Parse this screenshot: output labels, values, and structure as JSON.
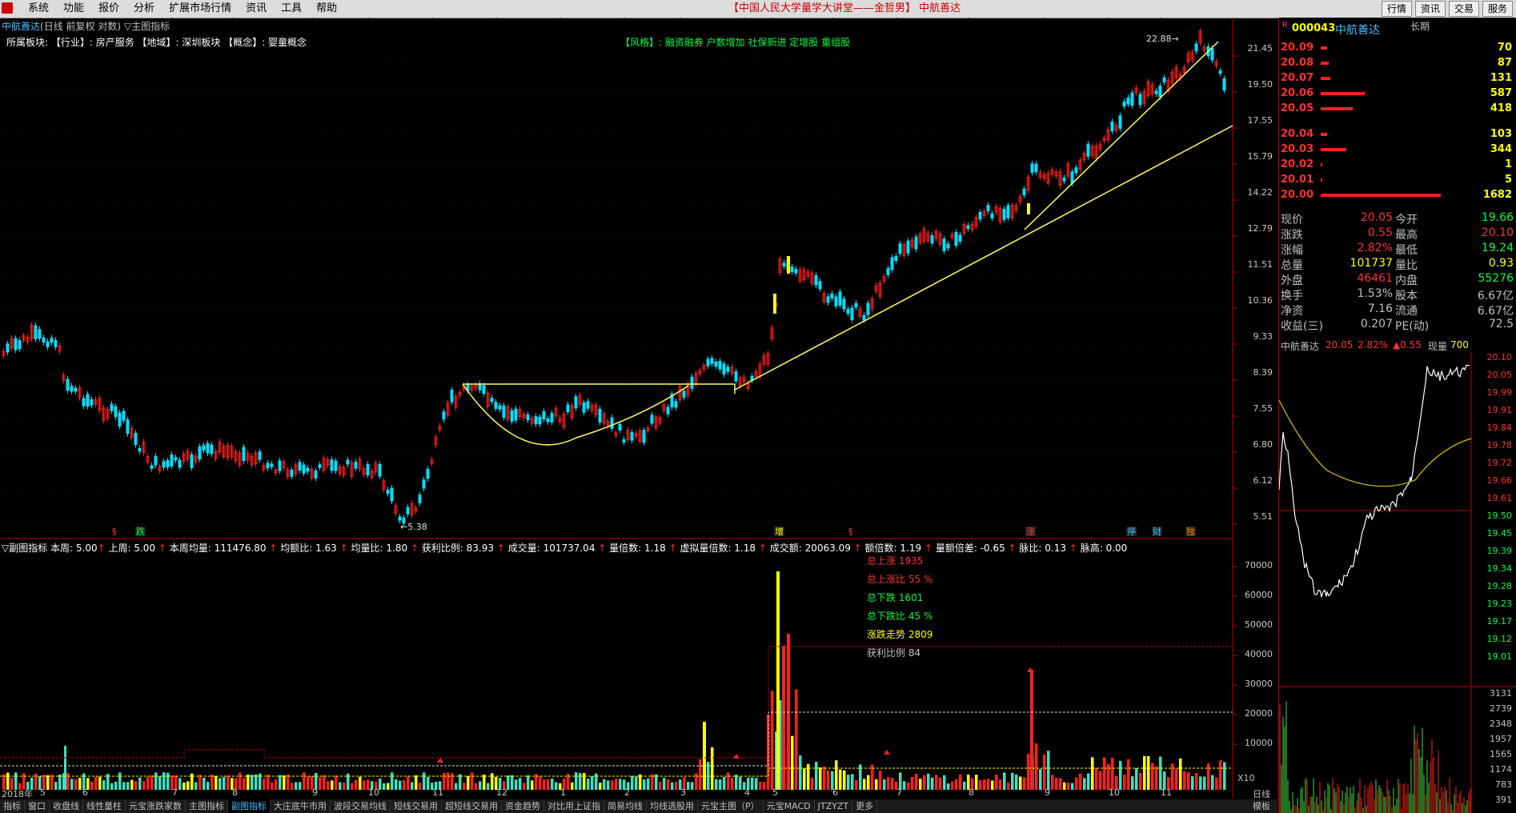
{
  "menu": {
    "items": [
      "系统",
      "功能",
      "报价",
      "分析",
      "扩展市场行情",
      "资讯",
      "工具",
      "帮助"
    ],
    "center": "【中国人民大学量学大讲堂——金哲男】  中航善达",
    "right_buttons": [
      "行情",
      "资讯",
      "交易",
      "服务"
    ]
  },
  "chart": {
    "name": "中航善达",
    "mode": "(日线 前复权 对数)",
    "indicator": "▽主图指标",
    "sector": "所属板块:  【行业】: 房产服务 【地域】: 深圳板块 【概念】: 婴童概念",
    "style": "【风格】: 融资融券 户数增加 社保新进 定增股 重组股",
    "high_mark": "22.88",
    "low_mark": "5.38",
    "price_ticks": [
      "21.45",
      "19.50",
      "17.55",
      "15.79",
      "14.22",
      "12.79",
      "11.51",
      "10.36",
      "9.33",
      "8.39",
      "7.55",
      "6.80",
      "6.12",
      "5.51"
    ],
    "events": [
      {
        "label": "跌",
        "color": "#00ff40"
      },
      {
        "label": "增",
        "color": "#ffff00"
      },
      {
        "label": "涨",
        "color": "#ff4040"
      },
      {
        "label": "停",
        "color": "#40c0ff"
      },
      {
        "label": "财",
        "color": "#40c0ff"
      },
      {
        "label": "独",
        "color": "#ff8000"
      }
    ]
  },
  "indicator_line": {
    "text": "▽副图指标 本周: 5.00",
    "items": [
      "上周: 5.00",
      "本周均量: 111476.80",
      "均额比: 1.63",
      "均量比: 1.80",
      "获利比例: 83.93"
    ],
    "items2": [
      "成交量: 101737.04",
      "量倍数: 1.18",
      "虚拟量倍数: 1.18",
      "成交额: 20063.09",
      "额倍数: 1.19",
      "量额倍差: -0.65",
      "脉比: 0.13",
      "脉高: 0.00"
    ]
  },
  "stats": [
    {
      "text": "总上涨 1935",
      "color": "#ff3030"
    },
    {
      "text": "总上涨比 55 %",
      "color": "#ff3030"
    },
    {
      "text": "总下跌 1601",
      "color": "#00ff40"
    },
    {
      "text": "总下跌比 45 %",
      "color": "#00ff40"
    },
    {
      "text": "涨跌走势 2809",
      "color": "#ffff00"
    },
    {
      "text": "获利比例 84",
      "color": "#c0c0c0"
    }
  ],
  "vol_ticks": [
    "70000",
    "60000",
    "50000",
    "40000",
    "30000",
    "20000",
    "10000"
  ],
  "vol_unit": "X10",
  "date_labels": [
    "2018年",
    "5",
    "6",
    "7",
    "8",
    "9",
    "10",
    "11",
    "12",
    "1",
    "2",
    "3",
    "4",
    "5",
    "6",
    "7",
    "8",
    "9",
    "10",
    "11"
  ],
  "tabs": [
    "指标",
    "窗口",
    "收盘线",
    "线性量柱",
    "元宝涨跌家数",
    "主图指标",
    "副图指标",
    "大庄底牛市用",
    "波段交易均线",
    "短线交易用",
    "超短线交易用",
    "资金趋势",
    "对比用上证指",
    "简易均线",
    "均线选股用",
    "元宝主图（P）",
    "元宝MACD",
    "JTZYZT",
    "更多"
  ],
  "active_tab": "副图指标",
  "side_tab": "模板",
  "side_tab2": "日线",
  "quote": {
    "code": "000043",
    "name": "中航善达",
    "tag": "长期",
    "asks": [
      {
        "price": "20.09",
        "vol": "70",
        "w": 8
      },
      {
        "price": "20.08",
        "vol": "87",
        "w": 10
      },
      {
        "price": "20.07",
        "vol": "131",
        "w": 12
      },
      {
        "price": "20.06",
        "vol": "587",
        "w": 55
      },
      {
        "price": "20.05",
        "vol": "418",
        "w": 40
      }
    ],
    "bids": [
      {
        "price": "20.04",
        "vol": "103",
        "w": 8
      },
      {
        "price": "20.03",
        "vol": "344",
        "w": 32
      },
      {
        "price": "20.02",
        "vol": "1",
        "w": 2
      },
      {
        "price": "20.01",
        "vol": "5",
        "w": 2
      },
      {
        "price": "20.00",
        "vol": "1682",
        "w": 150
      }
    ],
    "rows": [
      {
        "l": "现价",
        "v": "20.05",
        "vc": "#ff3030",
        "l2": "今开",
        "v2": "19.66",
        "v2c": "#00ff40"
      },
      {
        "l": "涨跌",
        "v": "0.55",
        "vc": "#ff3030",
        "l2": "最高",
        "v2": "20.10",
        "v2c": "#ff3030"
      },
      {
        "l": "涨幅",
        "v": "2.82%",
        "vc": "#ff3030",
        "l2": "最低",
        "v2": "19.24",
        "v2c": "#00ff40"
      },
      {
        "l": "总量",
        "v": "101737",
        "vc": "#ffff00",
        "l2": "量比",
        "v2": "0.93",
        "v2c": "#ffff00"
      },
      {
        "l": "外盘",
        "v": "46461",
        "vc": "#ff3030",
        "l2": "内盘",
        "v2": "55276",
        "v2c": "#00ff40"
      },
      {
        "l": "换手",
        "v": "1.53%",
        "vc": "#c0c0c0",
        "l2": "股本",
        "v2": "6.67亿",
        "v2c": "#c0c0c0"
      },
      {
        "l": "净资",
        "v": "7.16",
        "vc": "#c0c0c0",
        "l2": "流通",
        "v2": "6.67亿",
        "v2c": "#c0c0c0"
      },
      {
        "l": "收益(三)",
        "v": "0.207",
        "vc": "#c0c0c0",
        "l2": "PE(动)",
        "v2": "72.5",
        "v2c": "#c0c0c0"
      }
    ],
    "mini_title": "中航善达",
    "mini_price": "20.05",
    "mini_pct": "2.82%",
    "mini_chg": "▲0.55",
    "mini_vol_label": "现量",
    "mini_vol": "700",
    "mini_price_ticks": [
      "20.10",
      "20.05",
      "19.99",
      "19.91",
      "19.84",
      "19.78",
      "19.72",
      "19.66",
      "19.61",
      "19.50",
      "19.45",
      "19.39",
      "19.34",
      "19.28",
      "19.23",
      "19.17",
      "19.12",
      "19.01"
    ],
    "mini_vol_ticks": [
      "3131",
      "2739",
      "2348",
      "1957",
      "1565",
      "1174",
      "783",
      "391"
    ]
  },
  "colors": {
    "up": "#ff2020",
    "down": "#00e0ff",
    "vol_up": "#ff2020",
    "vol_down": "#40e0c0",
    "yellow": "#ffff00",
    "grid": "#600000"
  }
}
